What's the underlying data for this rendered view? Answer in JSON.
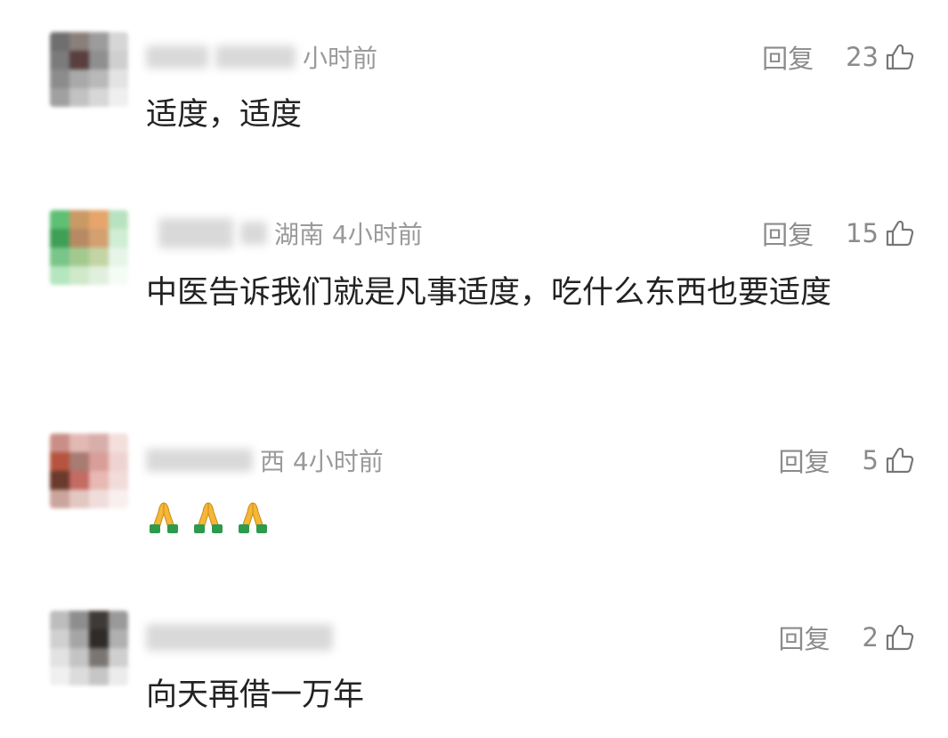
{
  "comments": [
    {
      "meta_visible": "小时前",
      "reply_label": "回复",
      "likes": "23",
      "text": "适度，适度",
      "like_icon": "thumbs-up-outline"
    },
    {
      "meta_visible": "湖南 4小时前",
      "reply_label": "回复",
      "likes": "15",
      "text": "中医告诉我们就是凡事适度，吃什么东西也要适度",
      "like_icon": "thumbs-up-outline"
    },
    {
      "meta_visible": "西 4小时前",
      "reply_label": "回复",
      "likes": "5",
      "emojis": [
        "folded-hands",
        "folded-hands",
        "folded-hands"
      ],
      "like_icon": "thumbs-up-outline"
    },
    {
      "meta_visible": "",
      "reply_label": "回复",
      "likes": "2",
      "text": "向天再借一万年",
      "like_icon": "thumbs-up-outline"
    }
  ],
  "colors": {
    "meta_gray": "#9a9a9a",
    "action_gray": "#8b8b8b",
    "body_text": "#222222",
    "emoji_skin": "#f6b736",
    "emoji_sleeve": "#2e9a4b"
  }
}
